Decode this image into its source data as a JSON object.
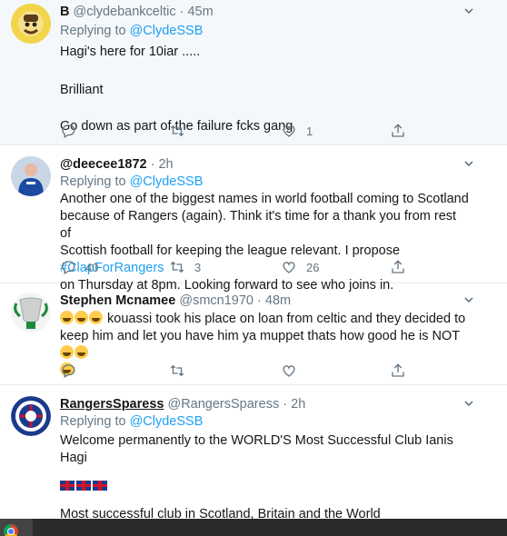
{
  "tweets": [
    {
      "name": "B",
      "handle": "@clydebankceltic",
      "sep": "·",
      "time": "45m",
      "replying_prefix": "Replying to",
      "replying_to": "@ClydeSSB",
      "lines": [
        "Hagi's here for 10iar .....",
        "",
        "Brilliant",
        "",
        "Go down as part of the failure fcks gang"
      ],
      "reply_count": "",
      "retweet_count": "",
      "like_count": "1"
    },
    {
      "name": "@deecee1872",
      "handle": "",
      "sep": "·",
      "time": "2h",
      "replying_prefix": "Replying to",
      "replying_to": "@ClydeSSB",
      "lines": [
        "Another one of the biggest names in world football coming to Scotland",
        "because of Rangers (again). Think it's time for a thank you from rest of",
        "Scottish football for keeping the league relevant. I propose"
      ],
      "hashtag": "#ClapForRangers",
      "line_last": "on Thursday at 8pm.  Looking forward to see who joins in.",
      "reply_count": "40",
      "retweet_count": "3",
      "like_count": "26"
    },
    {
      "name": "Stephen Mcnamee",
      "handle": "@smcn1970",
      "sep": "·",
      "time": "48m",
      "line1": "kouassi took his place on loan from celtic and they decided to",
      "line2": "keep him and let you have him ya muppet thats how good he is NOT",
      "reply_count": "",
      "retweet_count": "",
      "like_count": ""
    },
    {
      "name": "RangersSparess",
      "handle": "@RangersSparess",
      "sep": "·",
      "time": "2h",
      "replying_prefix": "Replying to",
      "replying_to": "@ClydeSSB",
      "line1": "Welcome permanently to the WORLD'S Most Successful Club Ianis Hagi",
      "line3": "Most successful club in Scotland, Britain and the World"
    }
  ],
  "icons": {
    "reply": "reply-icon",
    "retweet": "retweet-icon",
    "like": "heart-icon",
    "share": "share-icon",
    "caret": "chevron-down-icon"
  },
  "colors": {
    "link": "#1da1f2",
    "muted": "#657786",
    "highlight_bg": "#f5f8fa"
  }
}
